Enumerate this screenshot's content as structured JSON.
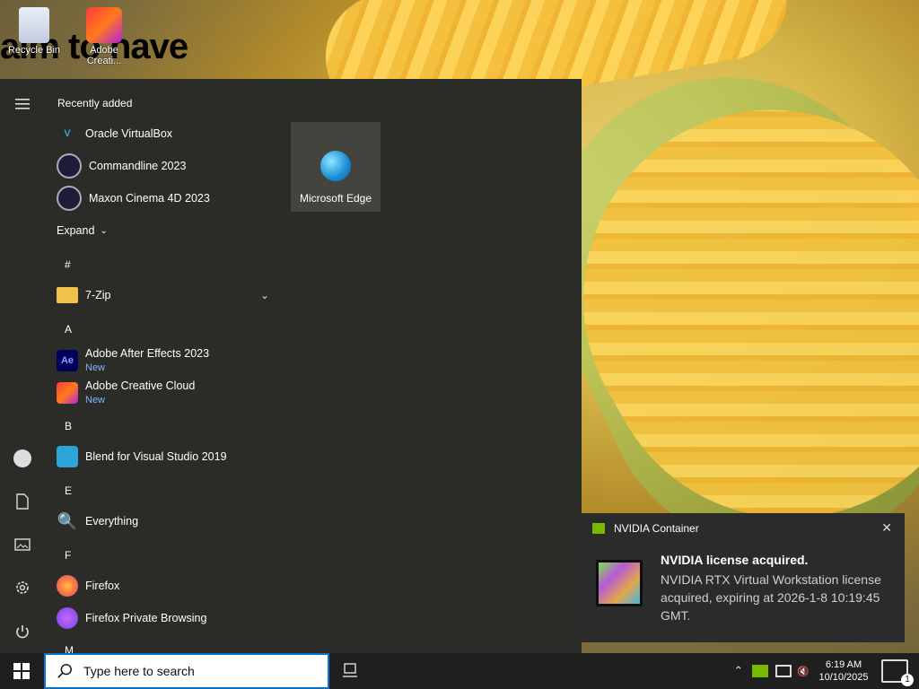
{
  "desktop": {
    "overlay_text": "aim to have",
    "icons": [
      {
        "label": "Recycle Bin"
      },
      {
        "label": "Adobe Creati..."
      }
    ]
  },
  "start_menu": {
    "recently_added_label": "Recently added",
    "recent": [
      {
        "label": "Oracle VirtualBox",
        "icon": "virtualbox-icon"
      },
      {
        "label": "Commandline 2023",
        "icon": "cinema4d-icon"
      },
      {
        "label": "Maxon Cinema 4D 2023",
        "icon": "cinema4d-icon"
      }
    ],
    "expand_label": "Expand",
    "sections": [
      {
        "letter": "#",
        "items": [
          {
            "label": "7-Zip",
            "icon": "folder-icon"
          }
        ]
      },
      {
        "letter": "A",
        "items": [
          {
            "label": "Adobe After Effects 2023",
            "sub": "New",
            "icon_text": "Ae"
          },
          {
            "label": "Adobe Creative Cloud",
            "sub": "New"
          }
        ]
      },
      {
        "letter": "B",
        "items": [
          {
            "label": "Blend for Visual Studio 2019"
          }
        ]
      },
      {
        "letter": "E",
        "items": [
          {
            "label": "Everything"
          }
        ]
      },
      {
        "letter": "F",
        "items": [
          {
            "label": "Firefox"
          },
          {
            "label": "Firefox Private Browsing"
          }
        ]
      },
      {
        "letter": "M",
        "items": []
      }
    ],
    "tile": {
      "label": "Microsoft Edge"
    }
  },
  "taskbar": {
    "search_placeholder": "Type here to search",
    "clock_time": "6:19 AM",
    "clock_date": "10/10/2025",
    "notification_count": "1"
  },
  "toast": {
    "app": "NVIDIA Container",
    "title": "NVIDIA license acquired.",
    "body": "NVIDIA RTX Virtual Workstation license acquired, expiring at 2026-1-8 10:19:45 GMT."
  },
  "colors": {
    "start_bg": "#2b2b27",
    "taskbar_bg": "#1f1f1f",
    "accent_blue": "#0a72ce",
    "new_badge": "#7fb7ff",
    "nvidia_green": "#76b900"
  }
}
